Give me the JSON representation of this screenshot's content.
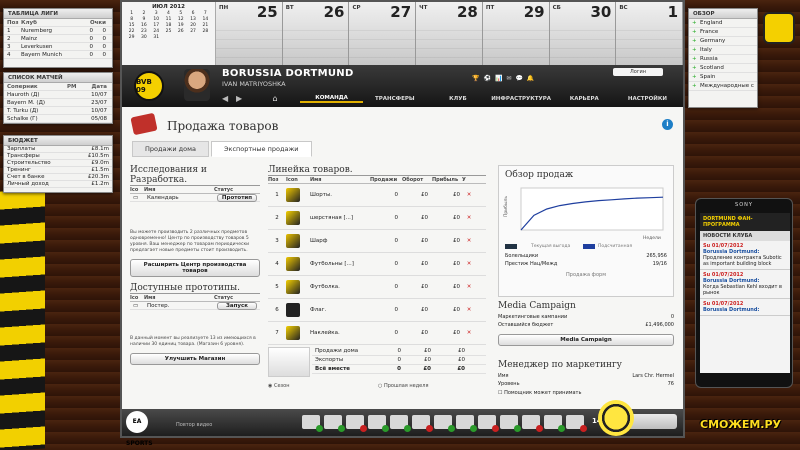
{
  "league_table": {
    "title": "ТАБЛИЦА ЛИГИ",
    "headers": [
      "Поз",
      "Клуб",
      "Очки"
    ],
    "rows": [
      {
        "pos": "1",
        "club": "Nuremberg",
        "a": "0",
        "b": "0"
      },
      {
        "pos": "2",
        "club": "Mainz",
        "a": "0",
        "b": "0"
      },
      {
        "pos": "3",
        "club": "Leverkusen",
        "a": "0",
        "b": "0"
      },
      {
        "pos": "4",
        "club": "Bayern Munich",
        "a": "0",
        "b": "0"
      }
    ]
  },
  "match_list": {
    "title": "СПИСОК МАТЧЕЙ",
    "headers": [
      "Соперник",
      "РМ",
      "Дата"
    ],
    "rows": [
      {
        "opponent": "Hauroth (Д)",
        "date": "10/07"
      },
      {
        "opponent": "Bayern M. (Д)",
        "date": "23/07"
      },
      {
        "opponent": "T. Turku (Д)",
        "date": "10/07"
      },
      {
        "opponent": "Schalke (Г)",
        "date": "05/08"
      }
    ]
  },
  "budget": {
    "title": "БЮДЖЕТ",
    "rows": [
      {
        "label": "Зарплаты",
        "value": "£8.1m"
      },
      {
        "label": "Трансферы",
        "value": "£10.5m"
      },
      {
        "label": "Строительство",
        "value": "£9.0m"
      },
      {
        "label": "Тренинг",
        "value": "£1.5m"
      },
      {
        "label": "Счет в банке",
        "value": "£20.3m"
      },
      {
        "label": "Личный доход",
        "value": "£1.2m"
      }
    ]
  },
  "calendar": {
    "month_title": "ИЮЛ 2012",
    "mini_days": [
      "1",
      "2",
      "3",
      "4",
      "5",
      "6",
      "7",
      "8",
      "9",
      "10",
      "11",
      "12",
      "13",
      "14",
      "15",
      "16",
      "17",
      "18",
      "19",
      "20",
      "21",
      "22",
      "23",
      "24",
      "25",
      "26",
      "27",
      "28",
      "29",
      "30",
      "31"
    ],
    "days": [
      {
        "name": "ПН",
        "num": "25"
      },
      {
        "name": "ВТ",
        "num": "26"
      },
      {
        "name": "СР",
        "num": "27"
      },
      {
        "name": "ЧТ",
        "num": "28"
      },
      {
        "name": "ПТ",
        "num": "29"
      },
      {
        "name": "СБ",
        "num": "30"
      },
      {
        "name": "ВС",
        "num": "1"
      }
    ]
  },
  "club": {
    "crest_text": "BVB 09",
    "name": "BORUSSIA DORTMUND",
    "manager": "IVAN MATRIYOSHKA",
    "login_label": "Логин",
    "top_icons": "🏆⚽📊✉💬🔔"
  },
  "nav": {
    "home_icon": "⌂",
    "back_icon": "◀",
    "forward_icon": "▶",
    "tabs": [
      "КОМАНДА",
      "ТРАНСФЕРЫ",
      "КЛУБ",
      "ИНФРАСТРУКТУРА",
      "КАРЬЕРА",
      "НАСТРОЙКИ"
    ]
  },
  "page": {
    "title": "Продажа товаров",
    "info_icon": "i",
    "subtabs": [
      "Продажи дома",
      "Экспортные продажи"
    ]
  },
  "research": {
    "title": "Исследования и Разработка.",
    "headers": [
      "Ico",
      "Имя",
      "Статус"
    ],
    "item_name": "Календарь",
    "item_status": "Прототип",
    "description": "Вы можете производить 2 различных предметов одновременно! Центр по производству товаров 5 уровня. Ваш менеджер по товарам периодически предлагает новые предметы стоит производить.",
    "expand_button": "Расширить Центр производства товаров"
  },
  "prototypes": {
    "title": "Доступные прототипы.",
    "headers": [
      "Ico",
      "Имя",
      "Статус"
    ],
    "item_name": "Постер.",
    "item_action": "Запуск",
    "description": "В данный момент вы реализуете 13 из имеющихся в наличии 30 единиц товара. (Магазин 6 уровня).",
    "upgrade_button": "Улучшить Магазин"
  },
  "product_line": {
    "title": "Линейка товаров.",
    "headers": [
      "Поз",
      "Icon",
      "Имя",
      "Продажи",
      "Оборот",
      "Прибыль",
      "У"
    ],
    "rows": [
      {
        "pos": "1",
        "name": "Шорты.",
        "sales": "0",
        "turnover": "£0",
        "profit": "£0",
        "color": "#f0c800"
      },
      {
        "pos": "2",
        "name": "шерстяная [...]",
        "sales": "0",
        "turnover": "£0",
        "profit": "£0",
        "color": "#f4d000"
      },
      {
        "pos": "3",
        "name": "Шарф",
        "sales": "0",
        "turnover": "£0",
        "profit": "£0",
        "color": "#e8c000"
      },
      {
        "pos": "4",
        "name": "Футбольны [...]",
        "sales": "0",
        "turnover": "£0",
        "profit": "£0",
        "color": "#f0c800"
      },
      {
        "pos": "5",
        "name": "Футболка.",
        "sales": "0",
        "turnover": "£0",
        "profit": "£0",
        "color": "#f4d000"
      },
      {
        "pos": "6",
        "name": "Флаг.",
        "sales": "0",
        "turnover": "£0",
        "profit": "£0",
        "color": "#222222"
      },
      {
        "pos": "7",
        "name": "Наклейка.",
        "sales": "0",
        "turnover": "£0",
        "profit": "£0",
        "color": "#f4d000"
      }
    ],
    "totals": [
      {
        "label": "Продажи дома",
        "sales": "0",
        "turnover": "£0",
        "profit": "£0"
      },
      {
        "label": "Экспорты",
        "sales": "0",
        "turnover": "£0",
        "profit": "£0"
      },
      {
        "label": "Всё вместе",
        "sales": "0",
        "turnover": "£0",
        "profit": "£0"
      }
    ],
    "radio_season": "Сезон",
    "radio_last_week": "Прошлая неделя"
  },
  "sales_review": {
    "title": "Обзор продаж",
    "y_axis_label": "Прибыль",
    "x_axis_label": "Недели",
    "legend_current": "Текущая выгода",
    "legend_expected": "Подсчитанная",
    "fans_label": "Болельщики",
    "fans_value": "265,956",
    "prestige_label": "Престиж Нац/Межд",
    "prestige_value": "19/16",
    "button": "Продажа форм"
  },
  "chart_data": {
    "type": "line",
    "title": "Обзор продаж",
    "xlabel": "Недели",
    "ylabel": "Прибыль",
    "series": [
      {
        "name": "Подсчитанная",
        "values": [
          0,
          0.35,
          0.5,
          0.58,
          0.63,
          0.67,
          0.7,
          0.72,
          0.74,
          0.76,
          0.77,
          0.78
        ]
      }
    ]
  },
  "media": {
    "title": "Media Campaign",
    "rows": [
      {
        "label": "Маркетинговые кампании",
        "value": "0"
      },
      {
        "label": "Оставшийся бюджет",
        "value": "£1,496,000"
      }
    ],
    "button": "Media Campaign"
  },
  "marketing": {
    "title": "Менеджер по маркетингу",
    "rows": [
      {
        "label": "Имя",
        "value": "Lars Chr. Hermel"
      },
      {
        "label": "Уровень",
        "value": "76"
      }
    ],
    "checkbox_label": "Помощник может принимать"
  },
  "bottom": {
    "ea_label": "EA SPORTS",
    "replay_label": "Повтор видео",
    "clock": "14:59",
    "icon_badges": [
      "green",
      "green",
      "red",
      "green",
      "green",
      "red",
      "green",
      "green",
      "red",
      "green",
      "red",
      "green",
      "red"
    ]
  },
  "overview": {
    "title": "ОБЗОР",
    "items": [
      "England",
      "France",
      "Germany",
      "Italy",
      "Russia",
      "Scotland",
      "Spain",
      "Международные соревнования"
    ]
  },
  "phone": {
    "brand": "SONY",
    "app_title": "DORTMUND ФАН-ПРОГРАММА",
    "section": "НОВОСТИ КЛУБА",
    "news": [
      {
        "date": "Su 01/07/2012",
        "from": "Borussia Dortmund:",
        "text": "Продление контракта Subotic as important building block"
      },
      {
        "date": "Su 01/07/2012",
        "from": "Borussia Dortmund:",
        "text": "Когда Sebastian Kehl входит в рынок"
      },
      {
        "date": "Su 01/07/2012",
        "from": "Borussia Dortmund:",
        "text": ""
      }
    ]
  },
  "watermark": {
    "text": "СМОЖЕМ.РУ"
  }
}
